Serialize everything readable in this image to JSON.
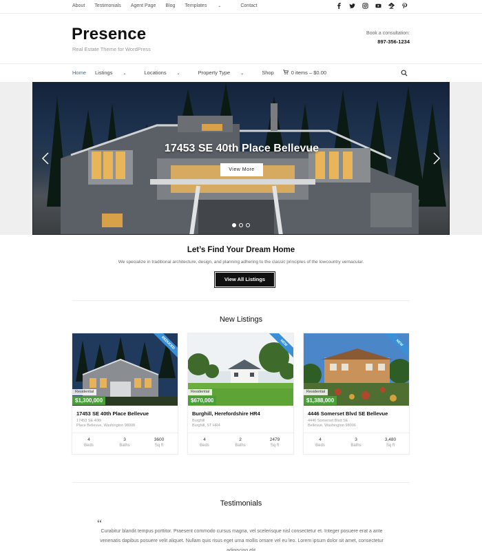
{
  "topbar": {
    "links": [
      "About",
      "Testimonials",
      "Agent Page",
      "Blog",
      "Templates",
      "Contact"
    ],
    "social_icons": [
      "facebook-icon",
      "twitter-icon",
      "instagram-icon",
      "youtube-icon",
      "zillow-icon",
      "pinterest-icon"
    ]
  },
  "header": {
    "logo": "Presence",
    "tagline": "Real Estate Theme for WordPress",
    "consult_label": "Book a consultation:",
    "phone": "897-356-1234"
  },
  "mainnav": {
    "home": "Home",
    "listings": "Listings",
    "locations": "Locations",
    "property_type": "Property Type",
    "shop": "Shop",
    "cart": "0 items – $0.00"
  },
  "hero": {
    "title": "17453 SE 40th Place Bellevue",
    "button": "View More",
    "slides": 3,
    "active_slide": 1
  },
  "intro": {
    "title": "Let’s Find Your Dream Home",
    "text": "We specialize in traditional architecture, design, and planning adhering to the classic principles of the lowcountry vernacular.",
    "button": "View All Listings"
  },
  "listings": {
    "title": "New Listings",
    "items": [
      {
        "ribbon": "REDUCED",
        "type": "Residential",
        "price": "$1,300,000",
        "name": "17453 SE 40th Place Bellevue",
        "addr1": "17453 SE 40th",
        "addr2": "Place Bellevue, Washington 98008",
        "beds": "4",
        "baths": "3",
        "sqft": "3600",
        "beds_label": "Beds",
        "baths_label": "Baths",
        "sqft_label": "Sq ft"
      },
      {
        "ribbon": "NEW",
        "type": "Residential",
        "price": "$670,000",
        "name": "Burghill, Herefordshire HR4",
        "addr1": "Burghill",
        "addr2": "Burghill, ST HR4",
        "beds": "4",
        "baths": "2",
        "sqft": "2479",
        "beds_label": "Beds",
        "baths_label": "Baths",
        "sqft_label": "Sq ft"
      },
      {
        "ribbon": "NEW",
        "type": "Residential",
        "price": "$1,388,000",
        "name": "4446 Somerset Blvd SE Bellevue",
        "addr1": "4446 Somerset Blvd SE",
        "addr2": "Bellevue, Washington 98006",
        "beds": "4",
        "baths": "3",
        "sqft": "3,480",
        "beds_label": "Beds",
        "baths_label": "Baths",
        "sqft_label": "Sq ft"
      }
    ]
  },
  "testimonials": {
    "title": "Testimonials",
    "quote_mark": "“",
    "text": "Curabitur blandit tempus porttitor. Praesent commodo cursus magna, vel scelerisque nisl consectetur et. Integer posuere erat a ante venenatis dapibus posuere velit aliquet. Nullam quis risus eget urna mollis ornare vel eu leo. Lorem ipsum dolor sit amet, consectetur adipiscing elit."
  },
  "colors": {
    "accent": "#2f6fb0",
    "price_green": "#49a03a",
    "ribbon_blue": "#3b8fd6"
  }
}
